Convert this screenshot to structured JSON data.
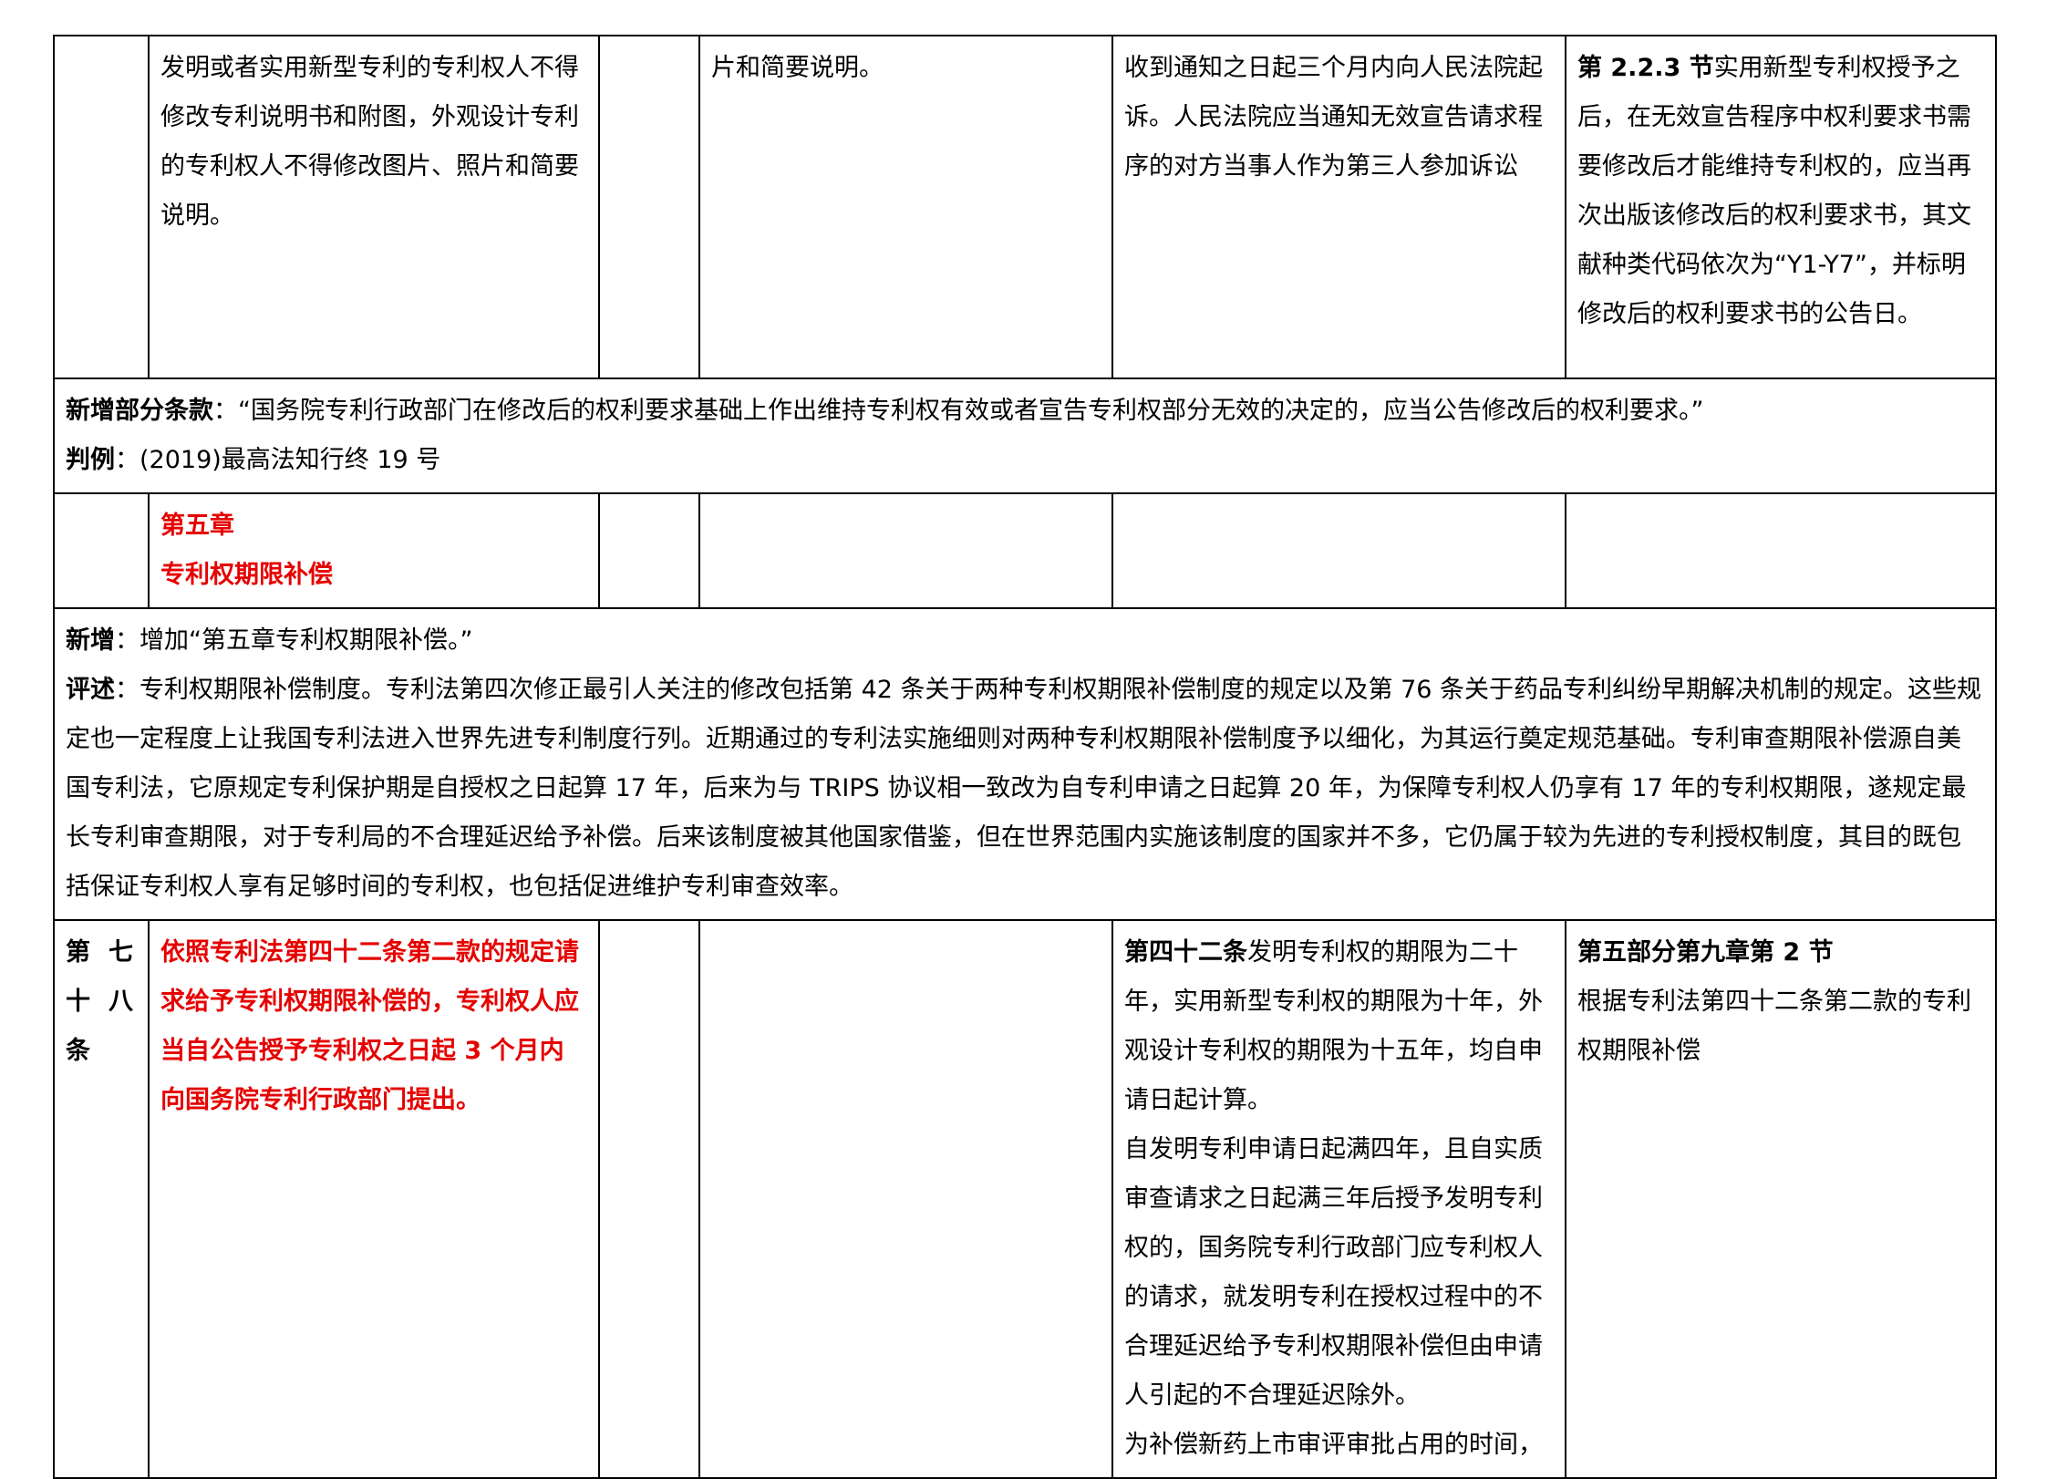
{
  "row1": {
    "col2": "发明或者实用新型专利的专利权人不得修改专利说明书和附图，外观设计专利的专利权人不得修改图片、照片和简要说明。",
    "col4": "片和简要说明。",
    "col5": "收到通知之日起三个月内向人民法院起诉。人民法院应当通知无效宣告请求程序的对方当事人作为第三人参加诉讼",
    "col6_bold": "第 2.2.3 节",
    "col6_text": "实用新型专利权授予之后，在无效宣告程序中权利要求书需要修改后才能维持专利权的，应当再次出版该修改后的权利要求书，其文献种类代码依次为“Y1-Y7”，并标明修改后的权利要求书的公告日。"
  },
  "note1": {
    "label1": "新增部分条款",
    "text1": "：“国务院专利行政部门在修改后的权利要求基础上作出维持专利权有效或者宣告专利权部分无效的决定的，应当公告修改后的权利要求。”",
    "label2": "判例",
    "text2": "：(2019)最高法知行终 19 号"
  },
  "chapter": {
    "line1": "第五章",
    "line2": "专利权期限补偿"
  },
  "note2": {
    "label1": "新增",
    "text1": "：增加“第五章专利权期限补偿。”",
    "label2": "评述",
    "text2": "：专利权期限补偿制度。专利法第四次修正最引人关注的修改包括第 42 条关于两种专利权期限补偿制度的规定以及第 76 条关于药品专利纠纷早期解决机制的规定。这些规定也一定程度上让我国专利法进入世界先进专利制度行列。近期通过的专利法实施细则对两种专利权期限补偿制度予以细化，为其运行奠定规范基础。专利审查期限补偿源自美国专利法，它原规定专利保护期是自授权之日起算 17 年，后来为与 TRIPS 协议相一致改为自专利申请之日起算 20 年，为保障专利权人仍享有 17 年的专利权期限，遂规定最长专利审查期限，对于专利局的不合理延迟给予补偿。后来该制度被其他国家借鉴，但在世界范围内实施该制度的国家并不多，它仍属于较为先进的专利授权制度，其目的既包括保证专利权人享有足够时间的专利权，也包括促进维护专利审查效率。"
  },
  "row3": {
    "article_line1": "第 七",
    "article_line2": "十 八",
    "article_line3": "条",
    "col2": "依照专利法第四十二条第二款的规定请求给予专利权期限补偿的，专利权人应当自公告授予专利权之日起 3 个月内向国务院专利行政部门提出。",
    "col5_bold": "第四十二条",
    "col5_p1": "发明专利权的期限为二十年，实用新型专利权的期限为十年，外观设计专利权的期限为十五年，均自申请日起计算。",
    "col5_p2": "自发明专利申请日起满四年，且自实质审查请求之日起满三年后授予发明专利权的，国务院专利行政部门应专利权人的请求，就发明专利在授权过程中的不合理延迟给予专利权期限补偿但由申请人引起的不合理延迟除外。",
    "col5_p3": "为补偿新药上市审评审批占用的时间，",
    "col6_bold": "第五部分第九章第 2 节",
    "col6_text": "根据专利法第四十二条第二款的专利权期限补偿"
  }
}
